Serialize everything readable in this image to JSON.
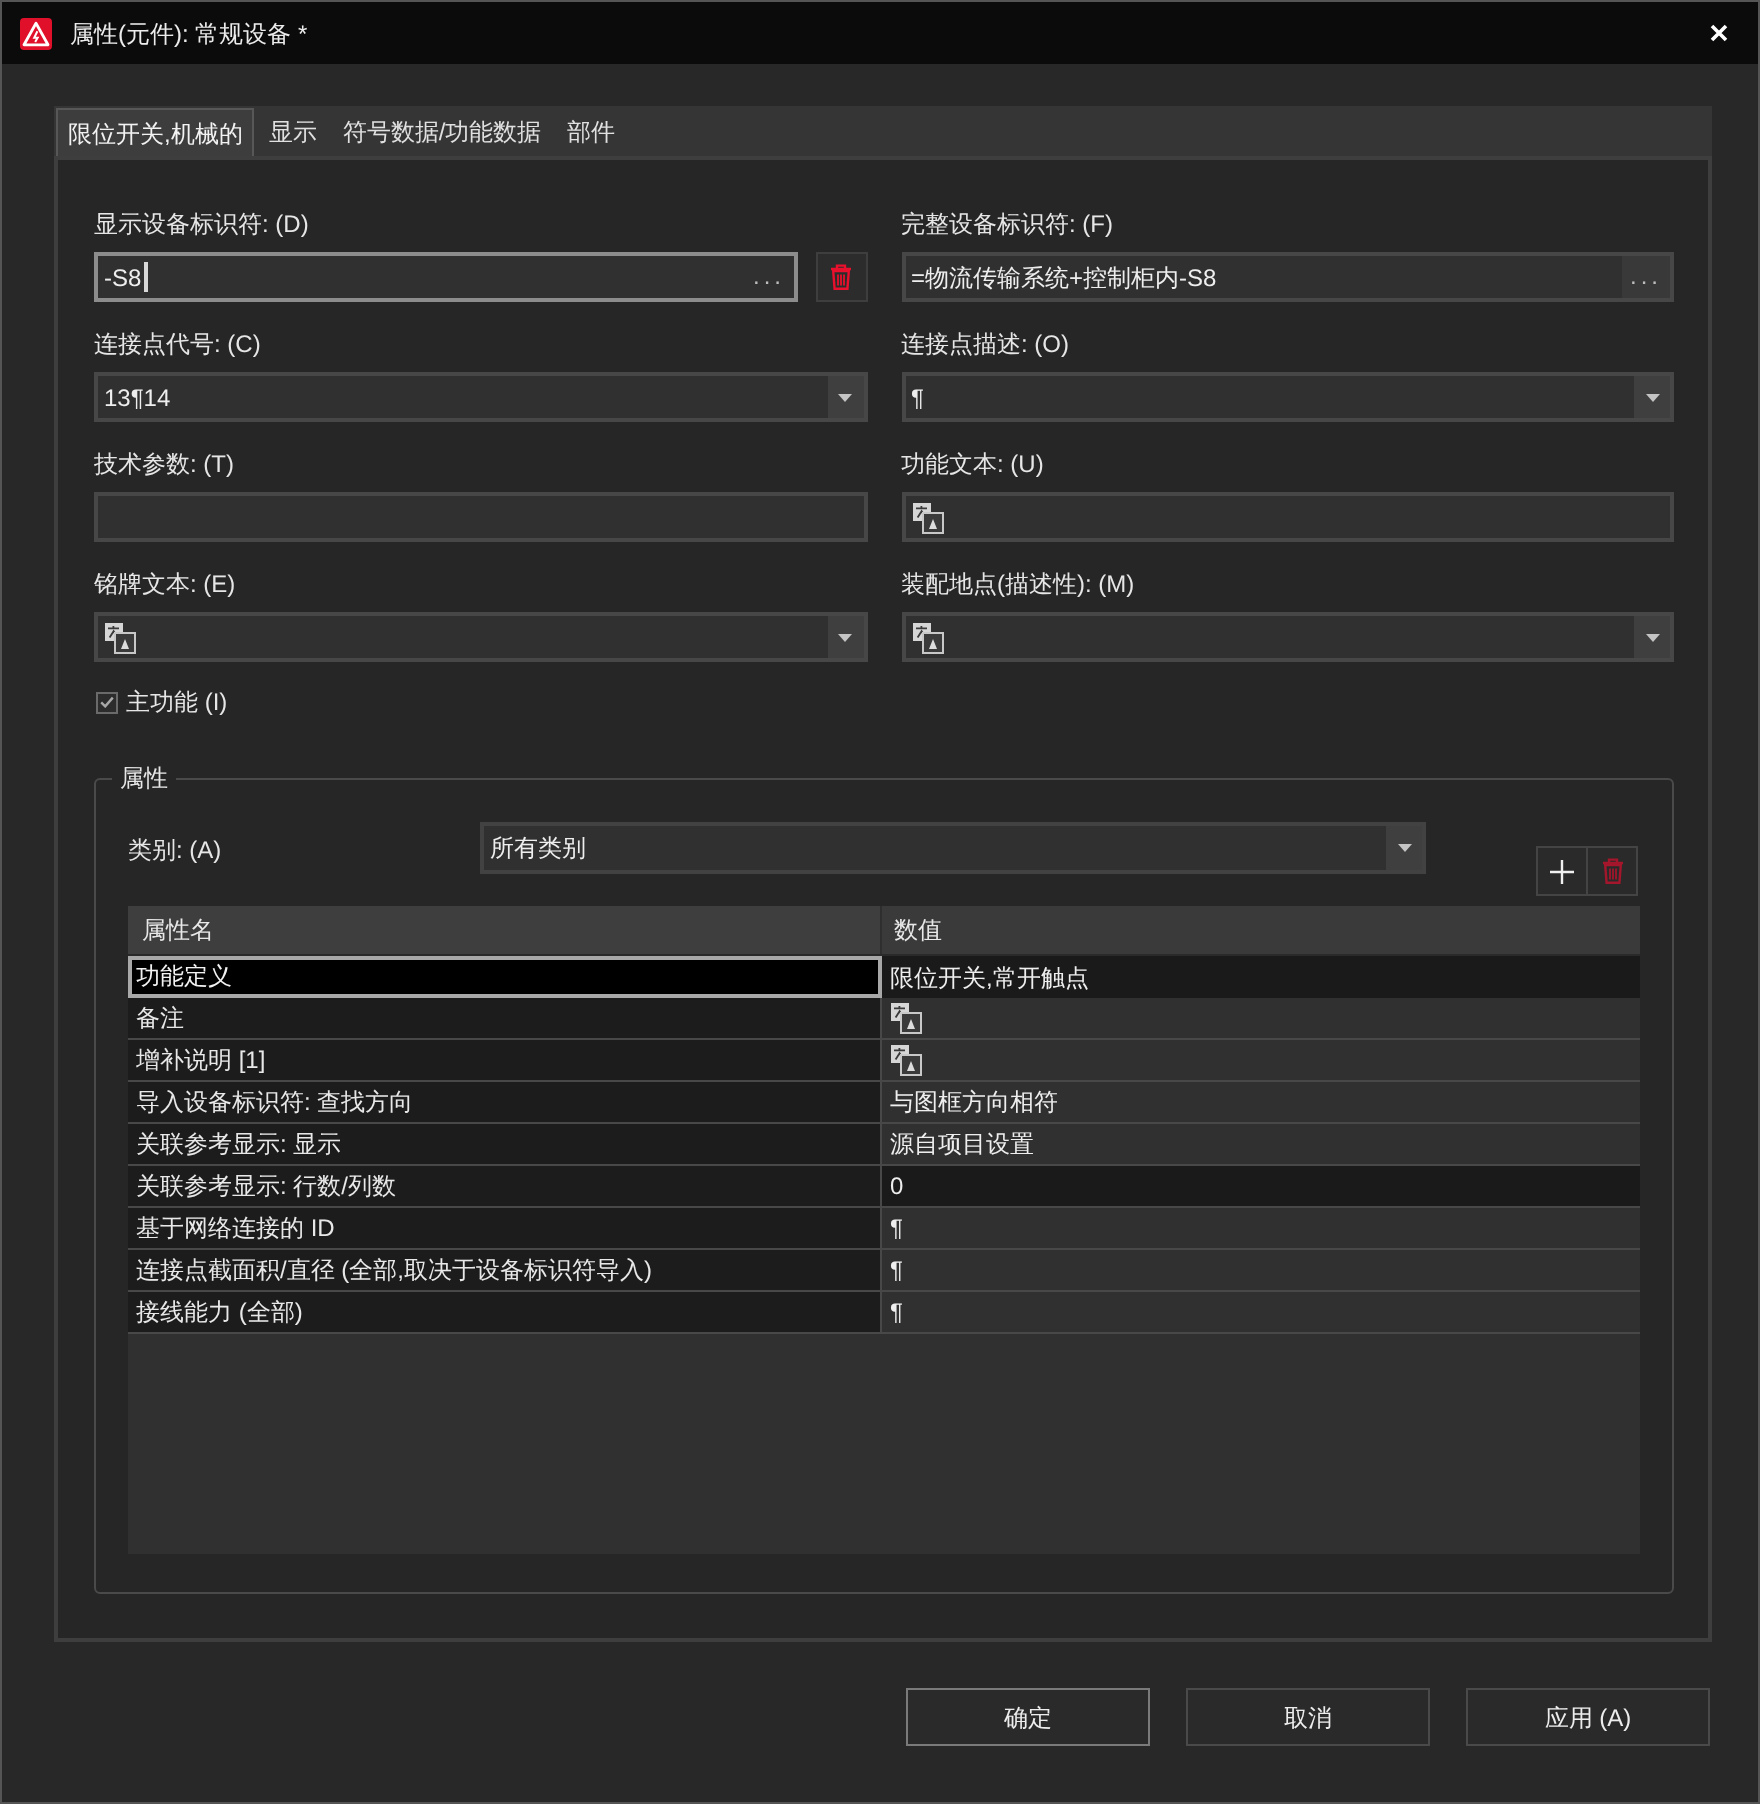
{
  "window": {
    "title": "属性(元件): 常规设备 *"
  },
  "tabs": [
    {
      "label": "限位开关,机械的",
      "selected": true
    },
    {
      "label": "显示",
      "selected": false
    },
    {
      "label": "符号数据/功能数据",
      "selected": false
    },
    {
      "label": "部件",
      "selected": false
    }
  ],
  "fields": [
    {
      "label": "显示设备标识符: (D)",
      "kind": "text",
      "value": "-S8",
      "focused": true,
      "multilingual": false,
      "button": "...",
      "delete_button": true
    },
    {
      "label": "完整设备标识符: (F)",
      "kind": "text",
      "value": "=物流传输系统+控制柜内-S8",
      "focused": false,
      "multilingual": false,
      "button": "..."
    },
    {
      "label": "连接点代号: (C)",
      "kind": "combo",
      "value": "13¶14",
      "focused": false,
      "multilingual": false
    },
    {
      "label": "连接点描述: (O)",
      "kind": "combo",
      "value": "¶",
      "focused": false,
      "multilingual": false
    },
    {
      "label": "技术参数: (T)",
      "kind": "text",
      "focused": false,
      "multilingual": false
    },
    {
      "label": "功能文本: (U)",
      "kind": "text",
      "focused": false,
      "multilingual": true
    },
    {
      "label": "铭牌文本: (E)",
      "kind": "combo",
      "focused": false,
      "multilingual": true
    },
    {
      "label": "装配地点(描述性): (M)",
      "kind": "combo",
      "focused": false,
      "multilingual": true
    }
  ],
  "checkbox": {
    "label": "主功能 (I)",
    "checked": true
  },
  "properties": {
    "title": "属性",
    "category": {
      "label": "类别: (A)",
      "value": "所有类别"
    },
    "toolbar": [
      {
        "kind": "add",
        "disabled": false
      },
      {
        "kind": "delete",
        "disabled": true
      }
    ],
    "table": {
      "columns": [
        "属性名",
        "数值"
      ],
      "rows": [
        {
          "name": "功能定义",
          "kind": "text",
          "value": "限位开关,常开触点",
          "selected": true,
          "highlighted": true
        },
        {
          "name": "备注",
          "kind": "multilingual",
          "selected": false,
          "highlighted": false
        },
        {
          "name": "增补说明 [1]",
          "kind": "multilingual",
          "selected": false,
          "highlighted": false
        },
        {
          "name": "导入设备标识符: 查找方向",
          "kind": "text",
          "value": "与图框方向相符",
          "selected": false,
          "highlighted": false
        },
        {
          "name": "关联参考显示: 显示",
          "kind": "text",
          "value": "源自项目设置",
          "selected": false,
          "highlighted": false
        },
        {
          "name": "关联参考显示: 行数/列数",
          "kind": "text",
          "value": "0",
          "selected": false,
          "highlighted": true
        },
        {
          "name": "基于网络连接的 ID",
          "kind": "text",
          "value": "¶",
          "selected": false,
          "highlighted": false
        },
        {
          "name": "连接点截面积/直径 (全部,取决于设备标识符导入)",
          "kind": "text",
          "value": "¶",
          "selected": false,
          "highlighted": false
        },
        {
          "name": "接线能力 (全部)",
          "kind": "text",
          "value": "¶",
          "selected": false,
          "highlighted": false
        }
      ]
    }
  },
  "buttons": [
    {
      "label": "确定",
      "default": true
    },
    {
      "label": "取消",
      "default": false
    },
    {
      "label": "应用 (A)",
      "default": false
    }
  ]
}
